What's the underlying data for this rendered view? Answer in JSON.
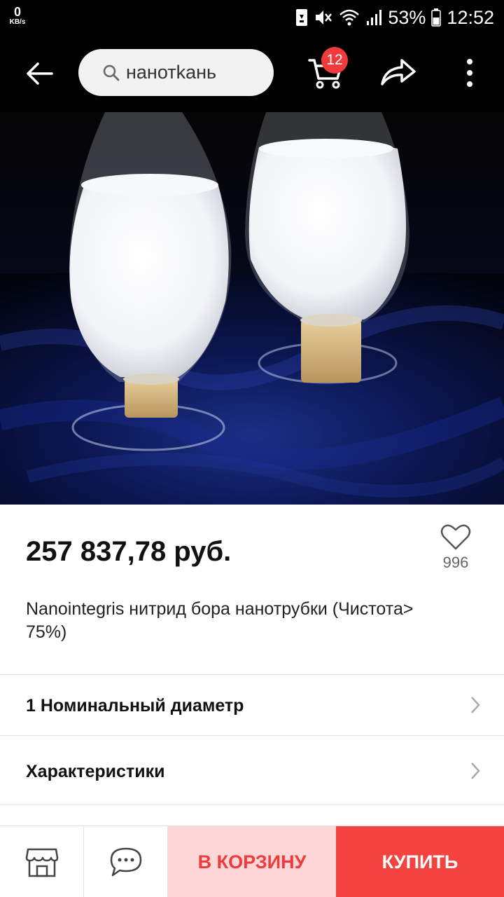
{
  "status_bar": {
    "net_speed_value": "0",
    "net_speed_unit": "KB/s",
    "battery": "53%",
    "time": "12:52"
  },
  "toolbar": {
    "search_query": "нанотkань",
    "cart_count": "12"
  },
  "product": {
    "price": "257 837,78 руб.",
    "favorites_count": "996",
    "title": "Nanointegris нитрид бора нанотрубки (Чистота> 75%)"
  },
  "sections": [
    {
      "label": "1 Номинальный диаметр"
    },
    {
      "label": "Характеристики"
    }
  ],
  "bottom_bar": {
    "add_to_cart_label": "В КОРЗИНУ",
    "buy_label": "КУПИТЬ"
  },
  "colors": {
    "accent": "#f2433f",
    "accent_light": "#fdd7d7",
    "badge": "#ef3b3b"
  }
}
